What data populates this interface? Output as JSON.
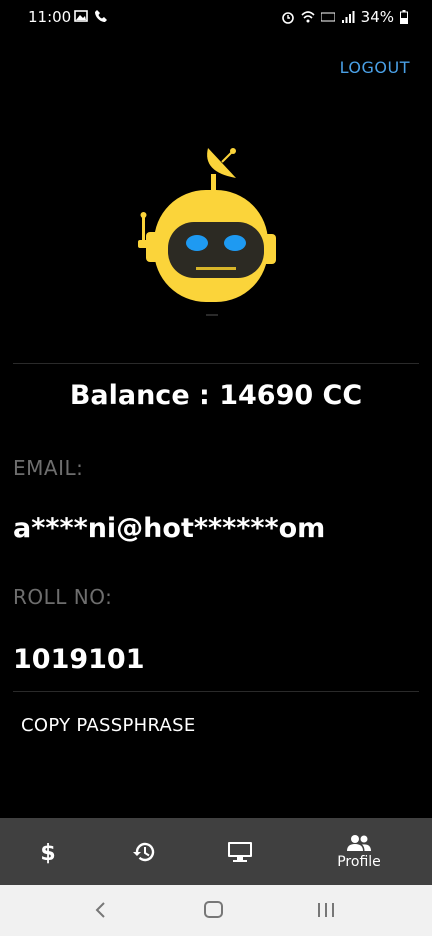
{
  "status": {
    "time": "11:00",
    "battery": "34%"
  },
  "header": {
    "logout_label": "LOGOUT"
  },
  "profile": {
    "balance": "Balance : 14690 CC",
    "email_label": "EMAIL:",
    "email_value": "a****ni@hot******om",
    "roll_label": "ROLL NO:",
    "roll_value": "1019101",
    "copy_label": "COPY PASSPHRASE"
  },
  "nav": {
    "items": [
      {
        "icon": "dollar-icon",
        "label": ""
      },
      {
        "icon": "history-icon",
        "label": ""
      },
      {
        "icon": "monitor-icon",
        "label": ""
      },
      {
        "icon": "people-icon",
        "label": "Profile"
      }
    ]
  },
  "colors": {
    "accent": "#4aa0e6",
    "robot_yellow": "#fbd43a",
    "robot_eye": "#1e9af2",
    "nav_bg": "#404040"
  }
}
